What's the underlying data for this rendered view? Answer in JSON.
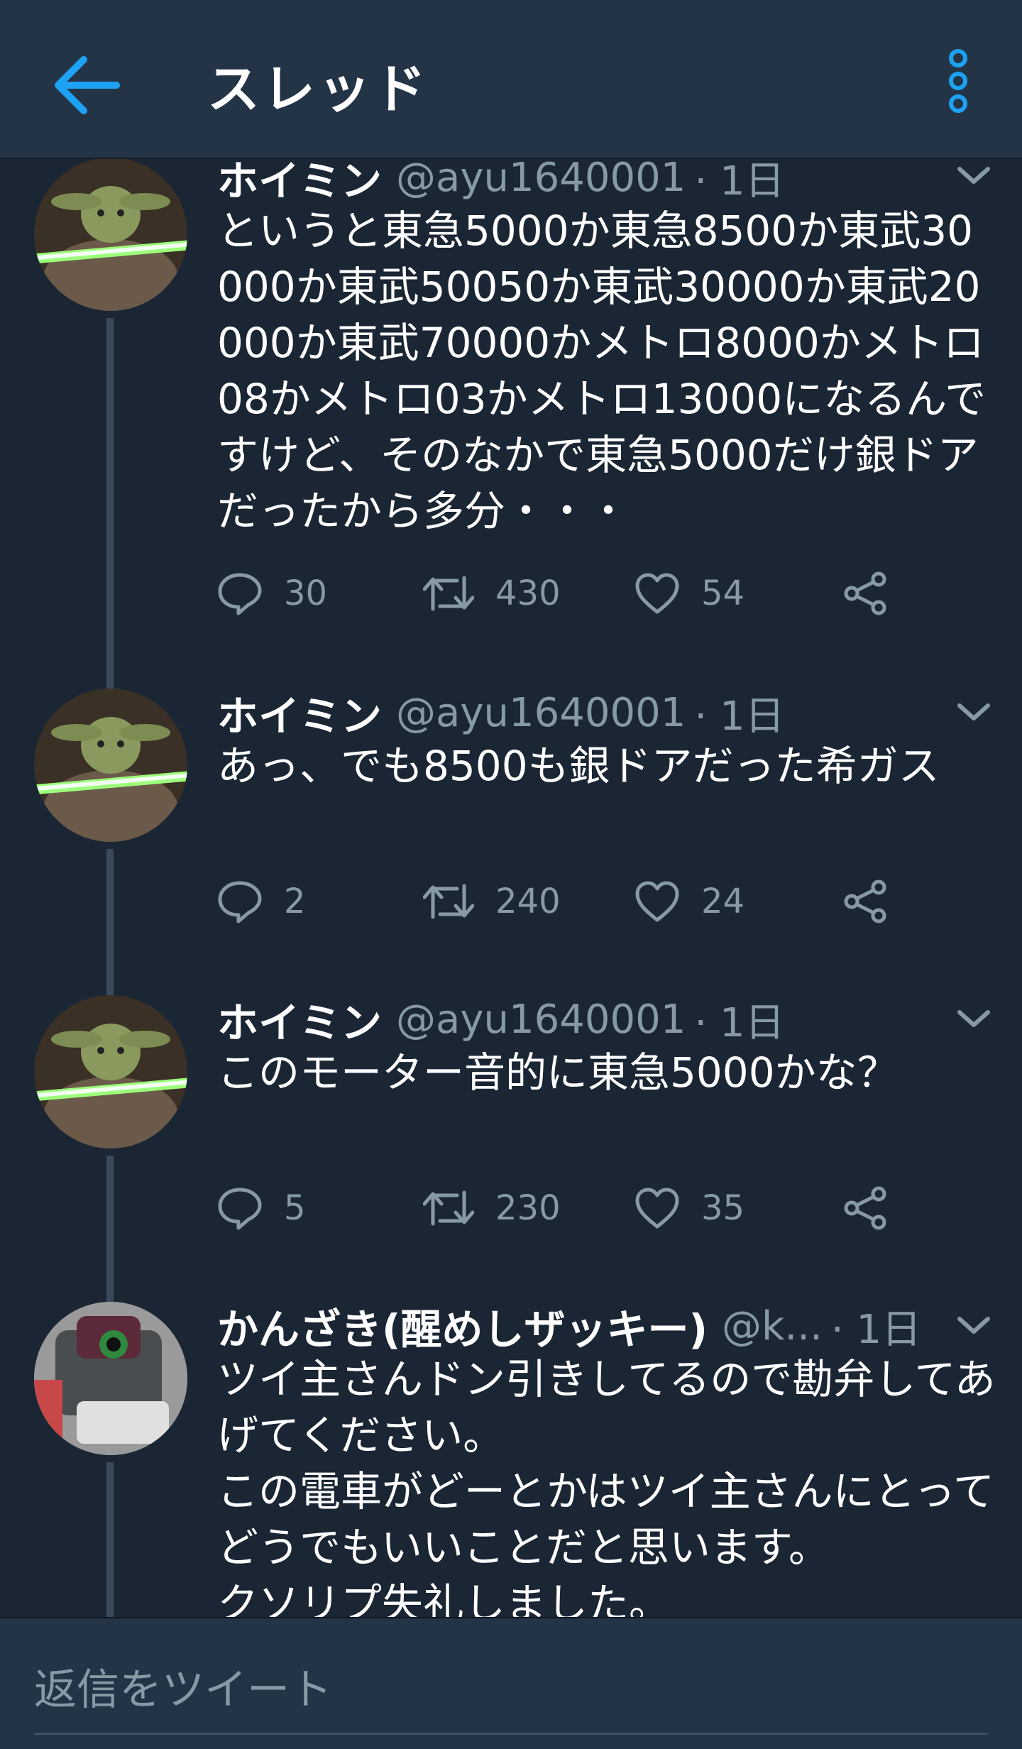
{
  "header": {
    "title": "スレッド",
    "back_icon": "arrow-left-icon",
    "more_icon": "vertical-dots-icon",
    "accent_color": "#1da1f2"
  },
  "tweets": [
    {
      "author": "ホイミン",
      "handle": "@ayu1640001",
      "time": "· 1日",
      "avatar": "yoda-lightsaber-avatar",
      "text": "というと東急5000か東急8500か東武30000か東武50050か東武30000か東武20000か東武70000かメトロ8000かメトロ08かメトロ03かメトロ13000になるんですけど、そのなかで東急5000だけ銀ドアだったから多分・・・",
      "reply_count": "30",
      "retweet_count": "430",
      "like_count": "54"
    },
    {
      "author": "ホイミン",
      "handle": "@ayu1640001",
      "time": "· 1日",
      "avatar": "yoda-lightsaber-avatar",
      "text": "あっ、でも8500も銀ドアだった希ガス",
      "reply_count": "2",
      "retweet_count": "240",
      "like_count": "24"
    },
    {
      "author": "ホイミン",
      "handle": "@ayu1640001",
      "time": "· 1日",
      "avatar": "yoda-lightsaber-avatar",
      "text": "このモーター音的に東急5000かな？",
      "reply_count": "5",
      "retweet_count": "230",
      "like_count": "35"
    },
    {
      "author": "かんざき(醒めしザッキー)",
      "handle": "@k...",
      "time": "· 1日",
      "avatar": "robot-figure-avatar",
      "text": "ツイ主さんドン引きしてるので勘弁してあげてください。\nこの電車がどーとかはツイ主さんにとってどうでもいいことだと思います。\nクソリプ失礼しました。"
    }
  ],
  "reply": {
    "placeholder": "返信をツイート"
  }
}
